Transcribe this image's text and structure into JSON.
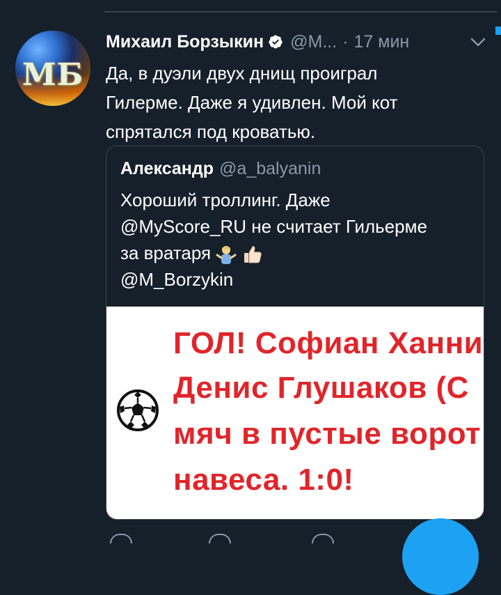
{
  "tweet": {
    "author_name": "Михаил Борзыкин",
    "author_handle": "@M...",
    "separator": "·",
    "time": "17 мин",
    "avatar_text": "МБ",
    "text_lines": [
      "Да, в дуэли двух днищ проиграл",
      "Гилерме. Даже я удивлен. Мой кот",
      "спрятался под кроватью."
    ]
  },
  "quoted": {
    "author_name": "Александр",
    "author_handle": "@a_balyanin",
    "text_lines": [
      "Хороший троллинг. Даже",
      "@MyScore_RU не считает Гильерме",
      "за вратаря",
      "@M_Borzykin"
    ],
    "emojis": [
      "man-shrugging-emoji",
      "thumbs-up-emoji"
    ],
    "image_text_lines": [
      "ГОЛ! Софиан Ханни",
      "Денис Глушаков (С",
      "мяч в пустые ворот",
      "навеса. 1:0!"
    ]
  },
  "colors": {
    "background": "#15202b",
    "secondary_text": "#8899a6",
    "border": "#38444d",
    "accent": "#1da1f2",
    "image_text": "#e0252a"
  }
}
